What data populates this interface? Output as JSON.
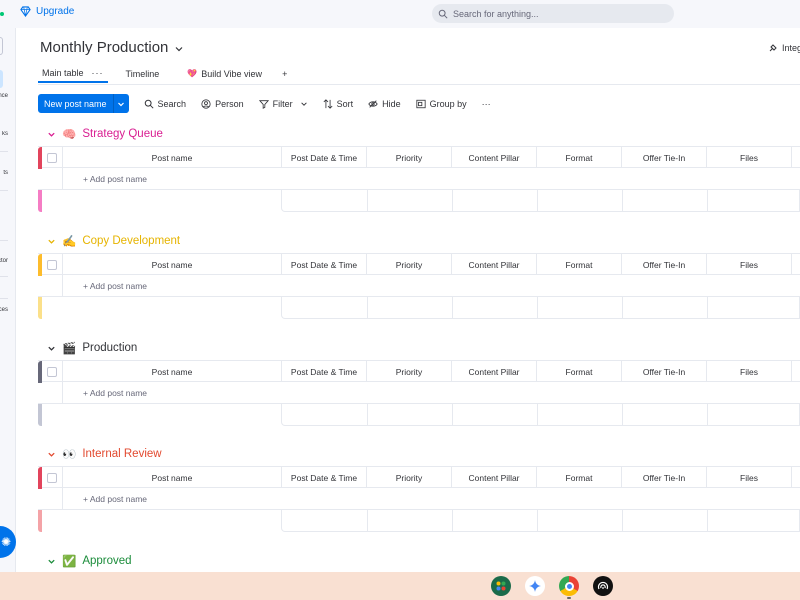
{
  "topbar": {
    "upgrade_label": "Upgrade",
    "search_placeholder": "Search for anything..."
  },
  "leftrail": {
    "labels": [
      "nce",
      "ks",
      "ts",
      "ctor",
      "ces"
    ]
  },
  "header": {
    "title": "Monthly Production",
    "integrate_label": "Integ"
  },
  "tabs": [
    {
      "label": "Main table",
      "active": true
    },
    {
      "label": "Timeline",
      "active": false
    },
    {
      "label": "Build Vibe view",
      "active": false
    }
  ],
  "tabs_add": "+",
  "tabs_more": "···",
  "toolbar": {
    "new_post": "New post name",
    "search": "Search",
    "person": "Person",
    "filter": "Filter",
    "sort": "Sort",
    "hide": "Hide",
    "group_by": "Group by",
    "more": "···"
  },
  "columns": [
    "Post name",
    "Post Date & Time",
    "Priority",
    "Content Pillar",
    "Format",
    "Offer Tie-In",
    "Files"
  ],
  "add_row_label": "+ Add post name",
  "groups": [
    {
      "emoji": "🧠",
      "name": "Strategy Queue",
      "color": "#e2445c",
      "text_color": "#d91d91",
      "light": "#f57dc4"
    },
    {
      "emoji": "✍️",
      "name": "Copy Development",
      "color": "#fdbc2c",
      "text_color": "#e6b400",
      "light": "#fbe08a"
    },
    {
      "emoji": "🎬",
      "name": "Production",
      "color": "#676879",
      "text_color": "#323338",
      "light": "#c3c6d4"
    },
    {
      "emoji": "👀",
      "name": "Internal Review",
      "color": "#e2445c",
      "text_color": "#e2492f",
      "light": "#f4a3a7"
    },
    {
      "emoji": "✅",
      "name": "Approved",
      "color": "#00c875",
      "text_color": "#1a8c3a",
      "light": "#8be6b4"
    }
  ],
  "taskbar": {
    "icons": [
      "apps-icon",
      "gemini-icon",
      "chrome-icon",
      "podcast-icon"
    ]
  }
}
